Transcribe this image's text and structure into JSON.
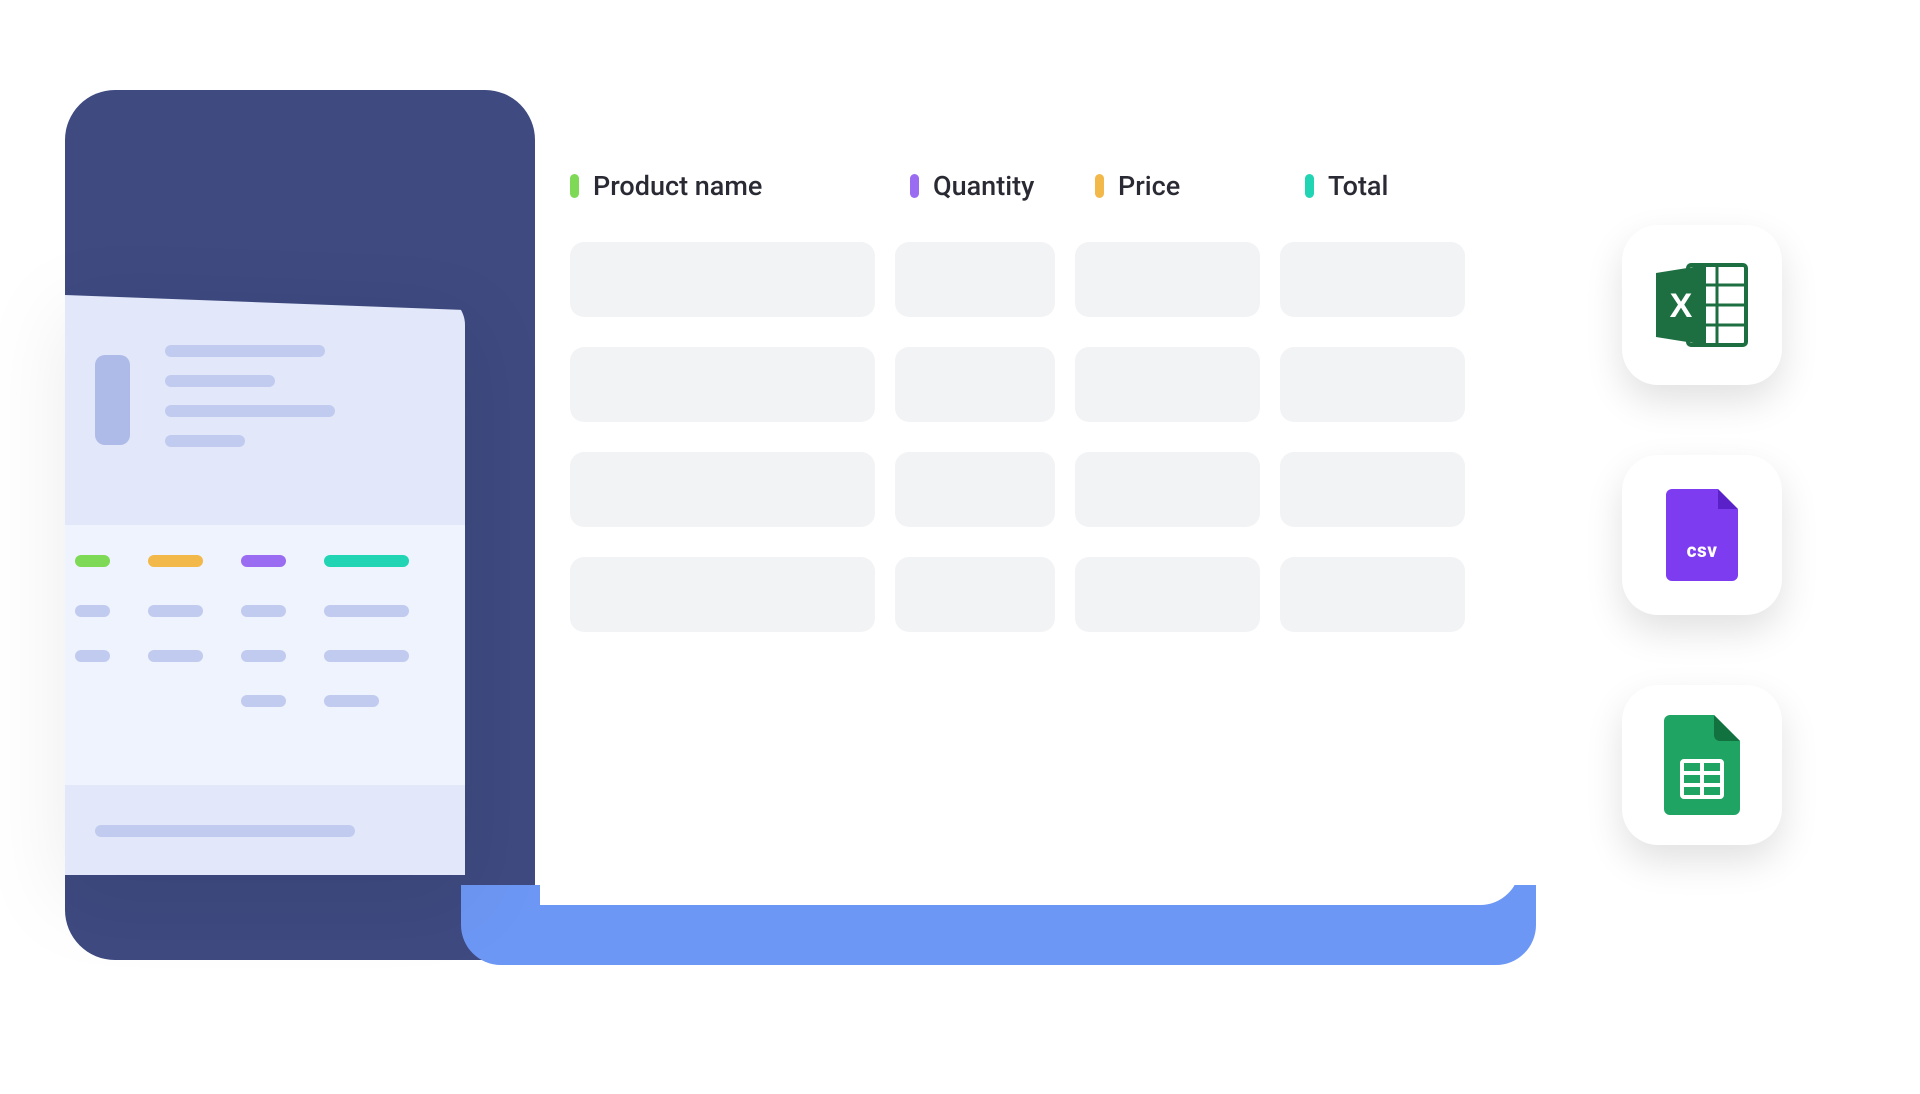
{
  "colors": {
    "green": "#7ed957",
    "purple": "#9a6cf2",
    "orange": "#f2b94a",
    "teal": "#21d4b4"
  },
  "table": {
    "columns": [
      {
        "label": "Product name",
        "color": "green"
      },
      {
        "label": "Quantity",
        "color": "purple"
      },
      {
        "label": "Price",
        "color": "orange"
      },
      {
        "label": "Total",
        "color": "teal"
      }
    ],
    "row_count": 4
  },
  "exports": {
    "excel": "Excel",
    "csv": "CSV",
    "sheets": "Google Sheets",
    "csv_label": "csv"
  }
}
